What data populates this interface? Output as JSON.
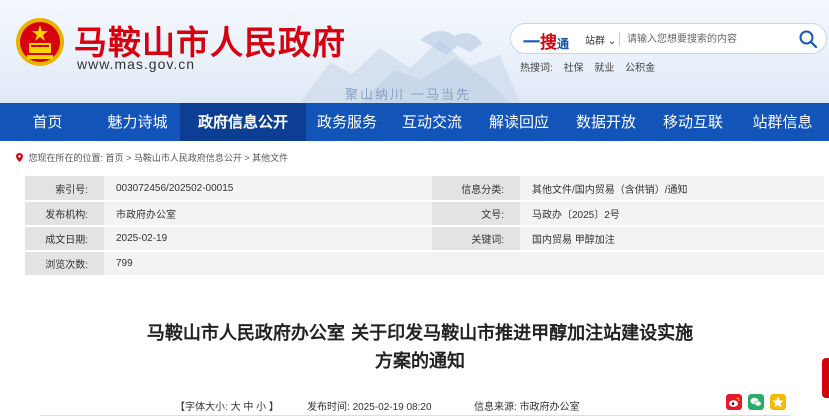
{
  "header": {
    "site_title": "马鞍山市人民政府",
    "site_url": "www.mas.gov.cn",
    "slogan": "聚山纳川  一马当先"
  },
  "search": {
    "logo_prefix": "一",
    "logo_mid": "搜",
    "logo_suffix": "通",
    "scope": "站群",
    "placeholder": "请输入您想要搜索的内容",
    "hotwords_label": "热搜词:",
    "hotwords": [
      "社保",
      "就业",
      "公积金"
    ]
  },
  "nav": {
    "items": [
      {
        "label": "首页"
      },
      {
        "label": "魅力诗城"
      },
      {
        "label": "政府信息公开",
        "active": true
      },
      {
        "label": "政务服务"
      },
      {
        "label": "互动交流"
      },
      {
        "label": "解读回应"
      },
      {
        "label": "数据开放"
      },
      {
        "label": "移动互联"
      },
      {
        "label": "站群信息"
      }
    ]
  },
  "breadcrumb": {
    "prefix": "您现在所在的位置:",
    "home": "首页",
    "level1": "马鞍山市人民政府信息公开",
    "level2": "其他文件",
    "sep": ">"
  },
  "info": {
    "index_no_label": "索引号:",
    "index_no": "003072456/202502-00015",
    "category_label": "信息分类:",
    "category": "其他文件/国内贸易（含供销）/通知",
    "publisher_label": "发布机构:",
    "publisher": "市政府办公室",
    "doc_no_label": "文号:",
    "doc_no": "马政办〔2025〕2号",
    "date_label": "成文日期:",
    "date": "2025-02-19",
    "keywords_label": "关键词:",
    "keywords": "国内贸易 甲醇加注",
    "views_label": "浏览次数:",
    "views": "799"
  },
  "article": {
    "title_line1": "马鞍山市人民政府办公室 关于印发马鞍山市推进甲醇加注站建设实施",
    "title_line2": "方案的通知",
    "font_size_label": "【字体大小:",
    "font_big": "大",
    "font_mid": "中",
    "font_small": "小",
    "font_end": "】",
    "published_label": "发布时间:",
    "published": "2025-02-19  08:20",
    "source_label": "信息来源:",
    "source": "市政府办公室"
  },
  "colors": {
    "brand_red": "#d7000f",
    "nav_blue": "#1254b8",
    "nav_active": "#0c3f93"
  }
}
